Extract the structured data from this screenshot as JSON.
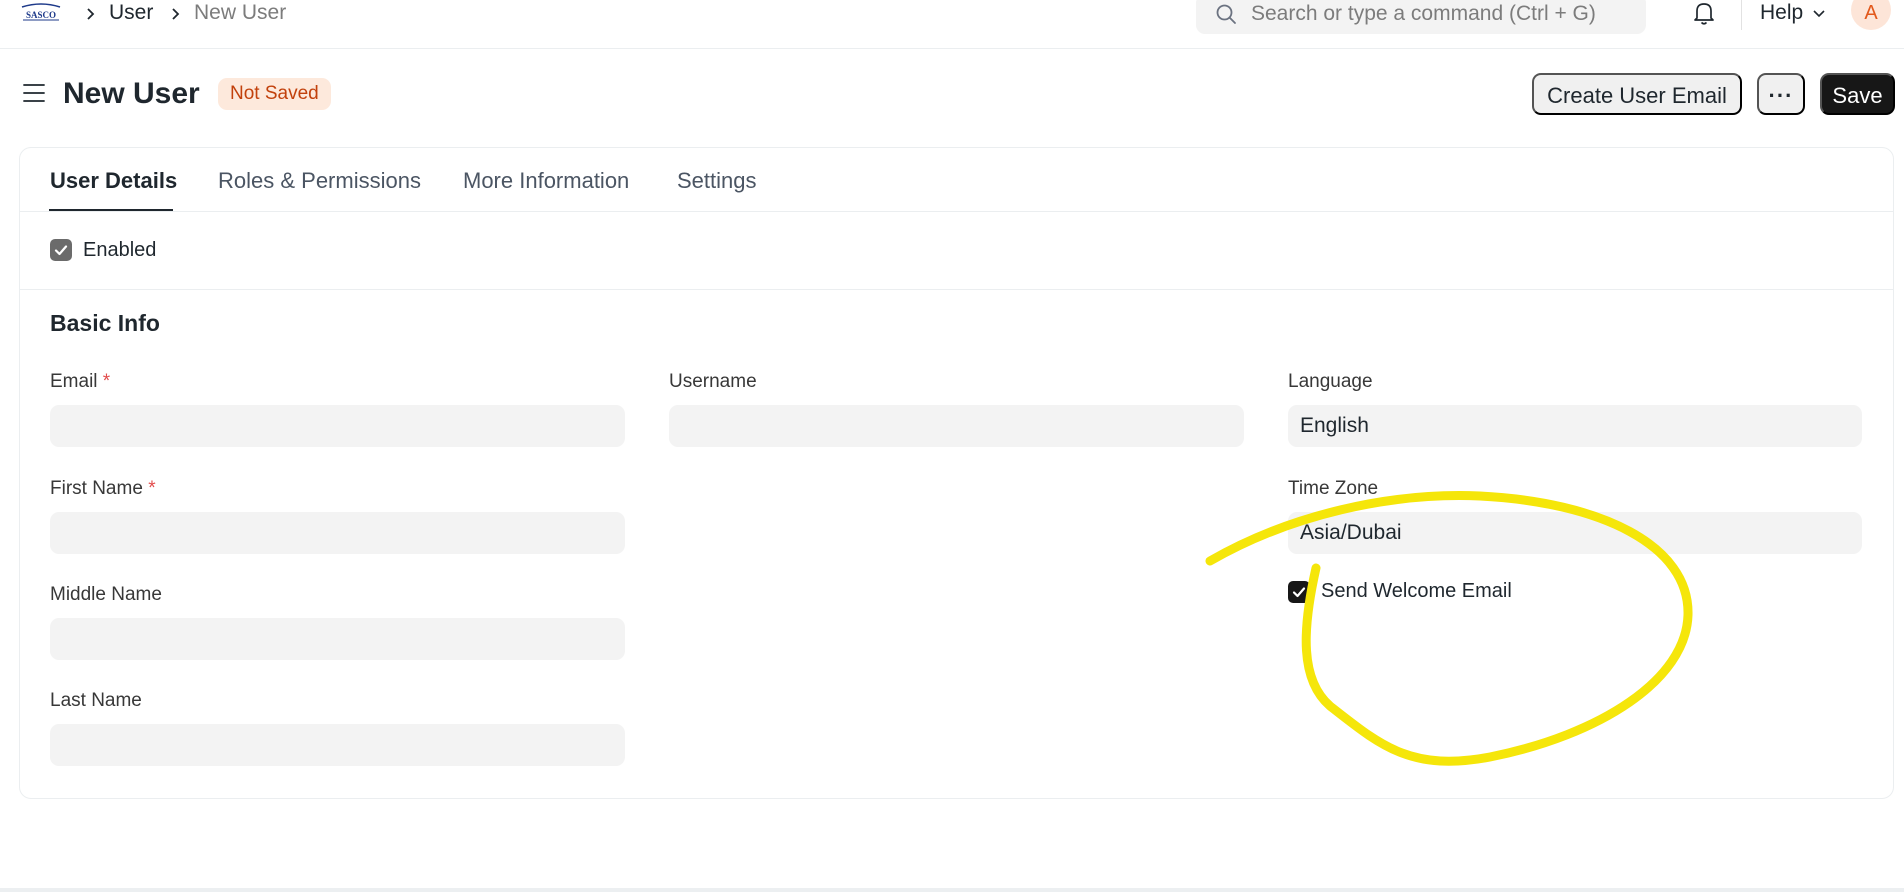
{
  "navbar": {
    "logo_text": "SASCO",
    "breadcrumbs": [
      "User",
      "New User"
    ],
    "search_placeholder": "Search or type a command (Ctrl + G)",
    "help_label": "Help",
    "avatar_initial": "A"
  },
  "page": {
    "title": "New User",
    "status": "Not Saved",
    "actions": {
      "create_user_email": "Create User Email",
      "more": "···",
      "save": "Save"
    }
  },
  "tabs": [
    {
      "label": "User Details",
      "active": true
    },
    {
      "label": "Roles & Permissions",
      "active": false
    },
    {
      "label": "More Information",
      "active": false
    },
    {
      "label": "Settings",
      "active": false
    }
  ],
  "form": {
    "enabled": {
      "label": "Enabled",
      "checked": true
    },
    "section_title": "Basic Info",
    "fields": {
      "email": {
        "label": "Email",
        "required": true,
        "value": ""
      },
      "first_name": {
        "label": "First Name",
        "required": true,
        "value": ""
      },
      "middle_name": {
        "label": "Middle Name",
        "value": ""
      },
      "last_name": {
        "label": "Last Name",
        "value": ""
      },
      "username": {
        "label": "Username",
        "value": ""
      },
      "language": {
        "label": "Language",
        "value": "English"
      },
      "time_zone": {
        "label": "Time Zone",
        "value": "Asia/Dubai"
      }
    },
    "send_welcome_email": {
      "label": "Send Welcome Email",
      "checked": true
    },
    "required_marker": "*"
  },
  "colors": {
    "accent_dark": "#171717",
    "badge_bg": "#fde9dc",
    "badge_text": "#c2410c",
    "annotation": "#f5e60a"
  }
}
